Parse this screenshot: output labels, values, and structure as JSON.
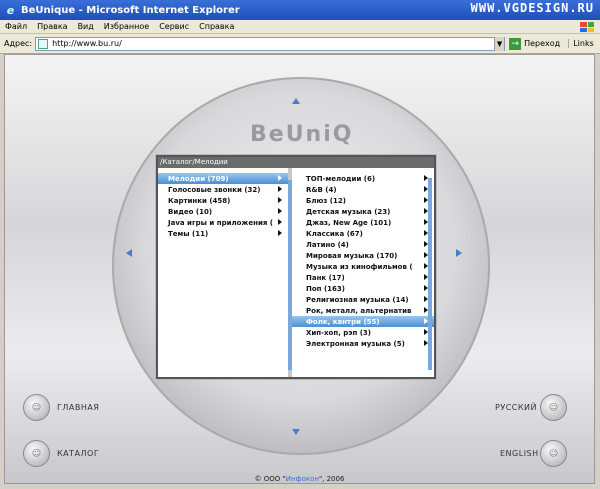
{
  "window": {
    "title": "BeUnique - Microsoft Internet Explorer",
    "brand": "WWW.VGDESIGN.RU"
  },
  "menu": [
    "Файл",
    "Правка",
    "Вид",
    "Избранное",
    "Сервис",
    "Справка"
  ],
  "address": {
    "label": "Адрес:",
    "url": "http://www.bu.ru/",
    "go_label": "Переход",
    "links_label": "Links"
  },
  "logo": "BeUniQ",
  "panel": {
    "title": "/Каталог/Мелодии",
    "left_items": [
      {
        "label": "Мелодии (709)",
        "selected": true
      },
      {
        "label": "Голосовые звонки (32)"
      },
      {
        "label": "Картинки (458)"
      },
      {
        "label": "Видео (10)"
      },
      {
        "label": "Java игры и приложения ("
      },
      {
        "label": "Темы (11)"
      }
    ],
    "right_items": [
      {
        "label": "ТОП-мелодии (6)"
      },
      {
        "label": "R&B (4)"
      },
      {
        "label": "Блюз (12)"
      },
      {
        "label": "Детская музыка (23)"
      },
      {
        "label": "Джаз, New Age (101)"
      },
      {
        "label": "Классика (67)"
      },
      {
        "label": "Латино (4)"
      },
      {
        "label": "Мировая музыка (170)"
      },
      {
        "label": "Музыка из кинофильмов ("
      },
      {
        "label": "Панк (17)"
      },
      {
        "label": "Поп (163)"
      },
      {
        "label": "Религиозная музыка (14)"
      },
      {
        "label": "Рок, металл, альтернатив"
      },
      {
        "label": "Фолк, кантри (55)",
        "selected": true
      },
      {
        "label": "Хип-хоп, рэп (3)"
      },
      {
        "label": "Электронная музыка (5)"
      }
    ]
  },
  "buttons": {
    "home": "ГЛАВНАЯ",
    "catalog": "КАТАЛОГ",
    "russian": "РУССКИЙ",
    "english": "ENGLISH"
  },
  "footer": {
    "prefix": "© ООО \"",
    "company": "Инфокон",
    "suffix": "\", 2006"
  }
}
